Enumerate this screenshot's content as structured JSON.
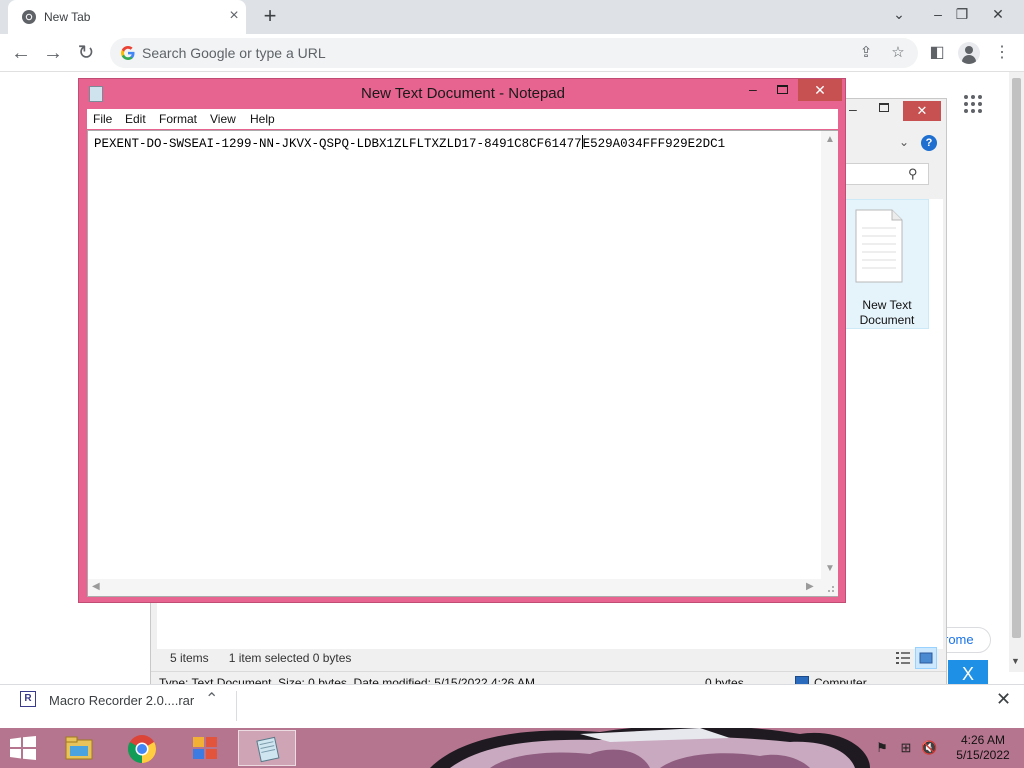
{
  "browser": {
    "tab_title": "New Tab",
    "omnibox_placeholder": "Search Google or type a URL",
    "customize_label": "rome",
    "blue_button_label": "X"
  },
  "download": {
    "file_name": "Macro Recorder 2.0....rar"
  },
  "explorer": {
    "file_name_line1": "New Text",
    "file_name_line2": "Document",
    "status_items": "5 items",
    "status_selected": "1 item selected  0 bytes",
    "details_info": "Type: Text Document, Size: 0 bytes, Date modified: 5/15/2022 4:26 AM",
    "details_size": "0 bytes",
    "details_location": "Computer"
  },
  "notepad": {
    "title": "New Text Document - Notepad",
    "menu": [
      "File",
      "Edit",
      "Format",
      "View",
      "Help"
    ],
    "content_before_caret": "PEXENT-DO-SWSEAI-1299-NN-JKVX-QSPQ-LDBX1ZLFLTXZLD17-8491C8CF61477",
    "content_after_caret": "E529A034FFF929E2DC1"
  },
  "taskbar": {
    "time": "4:26 AM",
    "date": "5/15/2022"
  }
}
